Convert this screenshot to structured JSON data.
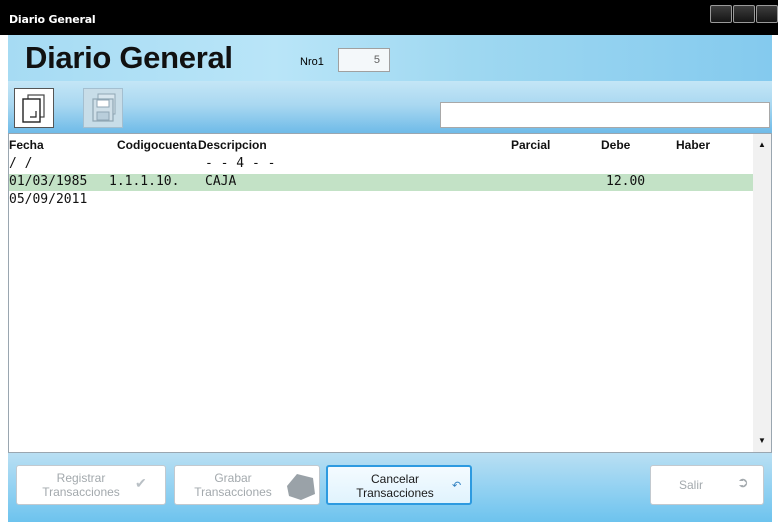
{
  "window": {
    "title": "Diario General"
  },
  "header": {
    "title": "Diario General",
    "nro_label": "Nro1",
    "nro_value": "5"
  },
  "toolbar": {
    "search_value": ""
  },
  "grid": {
    "columns": [
      "Fecha",
      "Codigocuenta",
      "Descripcion",
      "Parcial",
      "Debe",
      "Haber"
    ],
    "rows": [
      {
        "fecha": "/ /",
        "codigo": "",
        "descripcion": "- - 4 - -",
        "parcial": "",
        "debe": "",
        "haber": ""
      },
      {
        "fecha": "01/03/1985",
        "codigo": "1.1.1.10.",
        "descripcion": "CAJA",
        "parcial": "",
        "debe": "12.00",
        "haber": ""
      },
      {
        "fecha": "05/09/2011",
        "codigo": "",
        "descripcion": "",
        "parcial": "",
        "debe": "",
        "haber": ""
      }
    ]
  },
  "footer": {
    "registrar": {
      "line1": "Registrar",
      "line2": "Transacciones"
    },
    "grabar": {
      "line1": "Grabar",
      "line2": "Transacciones"
    },
    "cancelar": {
      "line1": "Cancelar",
      "line2": "Transacciones"
    },
    "salir": "Salir"
  },
  "colors": {
    "header_blue": "#a6dbf3",
    "selected_row": "#c3e2c6",
    "active_border": "#2d9ae0"
  }
}
